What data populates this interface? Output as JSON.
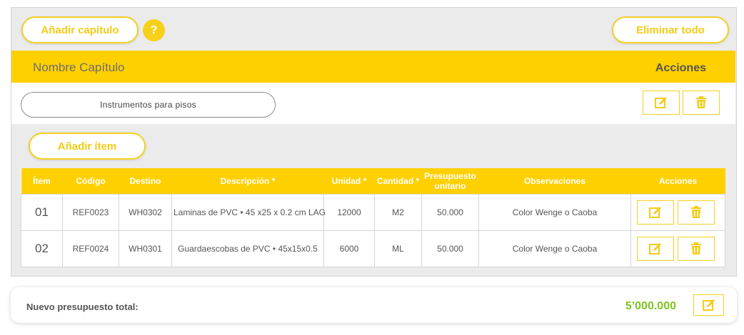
{
  "toolbar": {
    "add_chapter": "Añadir capítulo",
    "help": "?",
    "delete_all": "Eliminar todo"
  },
  "chapter_header": {
    "name_label": "Nombre Capítulo",
    "actions_label": "Acciones"
  },
  "chapter": {
    "name": "Instrumentos para pisos",
    "edit_icon": "edit-icon",
    "delete_icon": "trash-icon"
  },
  "items_toolbar": {
    "add_item": "Añadir ítem"
  },
  "table": {
    "headers": {
      "item": "Ítem",
      "code": "Código",
      "destination": "Destino",
      "description": "Descripción *",
      "unit": "Unidad *",
      "quantity": "Cantidad *",
      "unit_budget": "Presupuesto unitario",
      "notes": "Observaciones",
      "actions": "Acciones"
    },
    "rows": [
      {
        "item": "01",
        "code": "REF0023",
        "destination": "WH0302",
        "description": "Laminas de PVC • 45 x25 x 0.2 cm LAG",
        "unit": "12000",
        "quantity": "M2",
        "unit_budget": "50.000",
        "notes": "Color Wenge o Caoba"
      },
      {
        "item": "02",
        "code": "REF0024",
        "destination": "WH0301",
        "description": "Guardaescobas de PVC • 45x15x0.5",
        "unit": "6000",
        "quantity": "ML",
        "unit_budget": "50.000",
        "notes": "Color Wenge o Caoba"
      }
    ]
  },
  "total": {
    "label": "Nuevo presupuesto total:",
    "value": "5’000.000"
  },
  "colors": {
    "accent": "#ffd000",
    "button_text": "#f2cc16",
    "total_value": "#7dc521"
  }
}
